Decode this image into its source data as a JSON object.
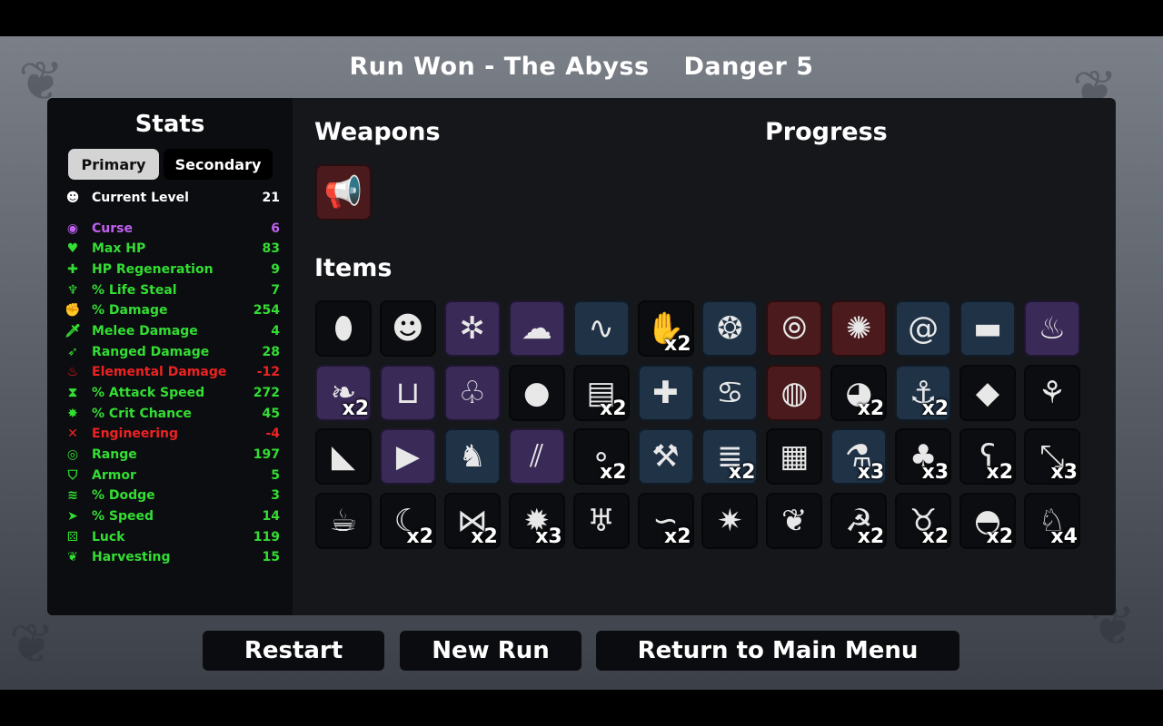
{
  "header": {
    "run_result": "Run Won - The Abyss",
    "danger": "Danger 5"
  },
  "stats": {
    "title": "Stats",
    "tabs": [
      "Primary",
      "Secondary"
    ],
    "rows": [
      {
        "label": "Current Level",
        "value": "21",
        "icon": "level-icon",
        "color": "#ffffff"
      },
      {
        "label": "Curse",
        "value": "6",
        "icon": "curse-icon",
        "color": "#c060f0"
      },
      {
        "label": "Max HP",
        "value": "83",
        "icon": "max-hp-icon",
        "color": "#33dd33"
      },
      {
        "label": "HP Regeneration",
        "value": "9",
        "icon": "hp-regeneration-icon",
        "color": "#33dd33"
      },
      {
        "label": "% Life Steal",
        "value": "7",
        "icon": "life-steal-icon",
        "color": "#33dd33"
      },
      {
        "label": "% Damage",
        "value": "254",
        "icon": "damage-icon",
        "color": "#33dd33"
      },
      {
        "label": "Melee Damage",
        "value": "4",
        "icon": "melee-damage-icon",
        "color": "#33dd33"
      },
      {
        "label": "Ranged Damage",
        "value": "28",
        "icon": "ranged-damage-icon",
        "color": "#33dd33"
      },
      {
        "label": "Elemental Damage",
        "value": "-12",
        "icon": "elemental-damage-icon",
        "color": "#ee2222"
      },
      {
        "label": "% Attack Speed",
        "value": "272",
        "icon": "attack-speed-icon",
        "color": "#33dd33"
      },
      {
        "label": "% Crit Chance",
        "value": "45",
        "icon": "crit-chance-icon",
        "color": "#33dd33"
      },
      {
        "label": "Engineering",
        "value": "-4",
        "icon": "engineering-icon",
        "color": "#ee2222"
      },
      {
        "label": "Range",
        "value": "197",
        "icon": "range-icon",
        "color": "#33dd33"
      },
      {
        "label": "Armor",
        "value": "5",
        "icon": "armor-icon",
        "color": "#33dd33"
      },
      {
        "label": "% Dodge",
        "value": "3",
        "icon": "dodge-icon",
        "color": "#33dd33"
      },
      {
        "label": "% Speed",
        "value": "14",
        "icon": "speed-icon",
        "color": "#33dd33"
      },
      {
        "label": "Luck",
        "value": "119",
        "icon": "luck-icon",
        "color": "#33dd33"
      },
      {
        "label": "Harvesting",
        "value": "15",
        "icon": "harvesting-icon",
        "color": "#33dd33"
      }
    ]
  },
  "weapons": {
    "title": "Weapons",
    "items": [
      {
        "icon": "megaphone-icon",
        "tier": 3
      }
    ]
  },
  "progress": {
    "title": "Progress"
  },
  "items": {
    "title": "Items",
    "rows": [
      [
        {
          "icon": "egg-icon",
          "tier": 0,
          "qty": ""
        },
        {
          "icon": "ghost-mask-icon",
          "tier": 0,
          "qty": ""
        },
        {
          "icon": "tardigrade-icon",
          "tier": 2,
          "qty": ""
        },
        {
          "icon": "purple-ghost-icon",
          "tier": 2,
          "qty": ""
        },
        {
          "icon": "worm-icon",
          "tier": 1,
          "qty": ""
        },
        {
          "icon": "bandaged-hand-icon",
          "tier": 0,
          "qty": "x2"
        },
        {
          "icon": "alien-eyes-icon",
          "tier": 1,
          "qty": ""
        },
        {
          "icon": "binoculars-icon",
          "tier": 3,
          "qty": ""
        },
        {
          "icon": "spider-icon",
          "tier": 3,
          "qty": ""
        },
        {
          "icon": "snail-icon",
          "tier": 1,
          "qty": ""
        },
        {
          "icon": "black-slime-icon",
          "tier": 1,
          "qty": ""
        },
        {
          "icon": "potion-flame-icon",
          "tier": 2,
          "qty": ""
        }
      ],
      [
        {
          "icon": "wings-icon",
          "tier": 2,
          "qty": "x2"
        },
        {
          "icon": "bucket-icon",
          "tier": 2,
          "qty": ""
        },
        {
          "icon": "bird-cage-icon",
          "tier": 2,
          "qty": ""
        },
        {
          "icon": "snowball-icon",
          "tier": 0,
          "qty": ""
        },
        {
          "icon": "treasure-map-icon",
          "tier": 0,
          "qty": "x2"
        },
        {
          "icon": "medical-robot-icon",
          "tier": 1,
          "qty": ""
        },
        {
          "icon": "octopus-icon",
          "tier": 1,
          "qty": ""
        },
        {
          "icon": "cow-belt-icon",
          "tier": 3,
          "qty": ""
        },
        {
          "icon": "spectral-eye-icon",
          "tier": 0,
          "qty": "x2"
        },
        {
          "icon": "chain-anchor-icon",
          "tier": 1,
          "qty": "x2"
        },
        {
          "icon": "meat-cleaver-icon",
          "tier": 0,
          "qty": ""
        },
        {
          "icon": "sprout-icon",
          "tier": 0,
          "qty": ""
        }
      ],
      [
        {
          "icon": "whistle-icon",
          "tier": 0,
          "qty": ""
        },
        {
          "icon": "triangle-prism-icon",
          "tier": 2,
          "qty": ""
        },
        {
          "icon": "rabbit-icon",
          "tier": 1,
          "qty": ""
        },
        {
          "icon": "claw-scratch-icon",
          "tier": 2,
          "qty": ""
        },
        {
          "icon": "pearls-icon",
          "tier": 0,
          "qty": "x2"
        },
        {
          "icon": "wrench-icon",
          "tier": 1,
          "qty": ""
        },
        {
          "icon": "scarf-icon",
          "tier": 1,
          "qty": "x2"
        },
        {
          "icon": "plaid-shirt-icon",
          "tier": 0,
          "qty": ""
        },
        {
          "icon": "flask-icon",
          "tier": 1,
          "qty": "x3"
        },
        {
          "icon": "tree-icon",
          "tier": 0,
          "qty": "x3"
        },
        {
          "icon": "teddy-bear-icon",
          "tier": 0,
          "qty": "x2"
        },
        {
          "icon": "syringe-icon",
          "tier": 0,
          "qty": "x3"
        }
      ],
      [
        {
          "icon": "coffee-cup-icon",
          "tier": 0,
          "qty": ""
        },
        {
          "icon": "white-fang-icon",
          "tier": 0,
          "qty": "x2"
        },
        {
          "icon": "fish-icon",
          "tier": 0,
          "qty": "x2"
        },
        {
          "icon": "dynamite-icon",
          "tier": 0,
          "qty": "x3"
        },
        {
          "icon": "tooth-icon",
          "tier": 0,
          "qty": ""
        },
        {
          "icon": "dolphin-icon",
          "tier": 0,
          "qty": "x2"
        },
        {
          "icon": "hedgehog-icon",
          "tier": 0,
          "qty": ""
        },
        {
          "icon": "feather-icon",
          "tier": 0,
          "qty": ""
        },
        {
          "icon": "scythe-icon",
          "tier": 0,
          "qty": "x2"
        },
        {
          "icon": "cat-icon",
          "tier": 0,
          "qty": "x2"
        },
        {
          "icon": "propeller-hat-icon",
          "tier": 0,
          "qty": "x2"
        },
        {
          "icon": "rubber-duck-icon",
          "tier": 0,
          "qty": "x4"
        }
      ]
    ]
  },
  "buttons": {
    "restart": "Restart",
    "new_run": "New Run",
    "return_main": "Return to Main Menu"
  }
}
